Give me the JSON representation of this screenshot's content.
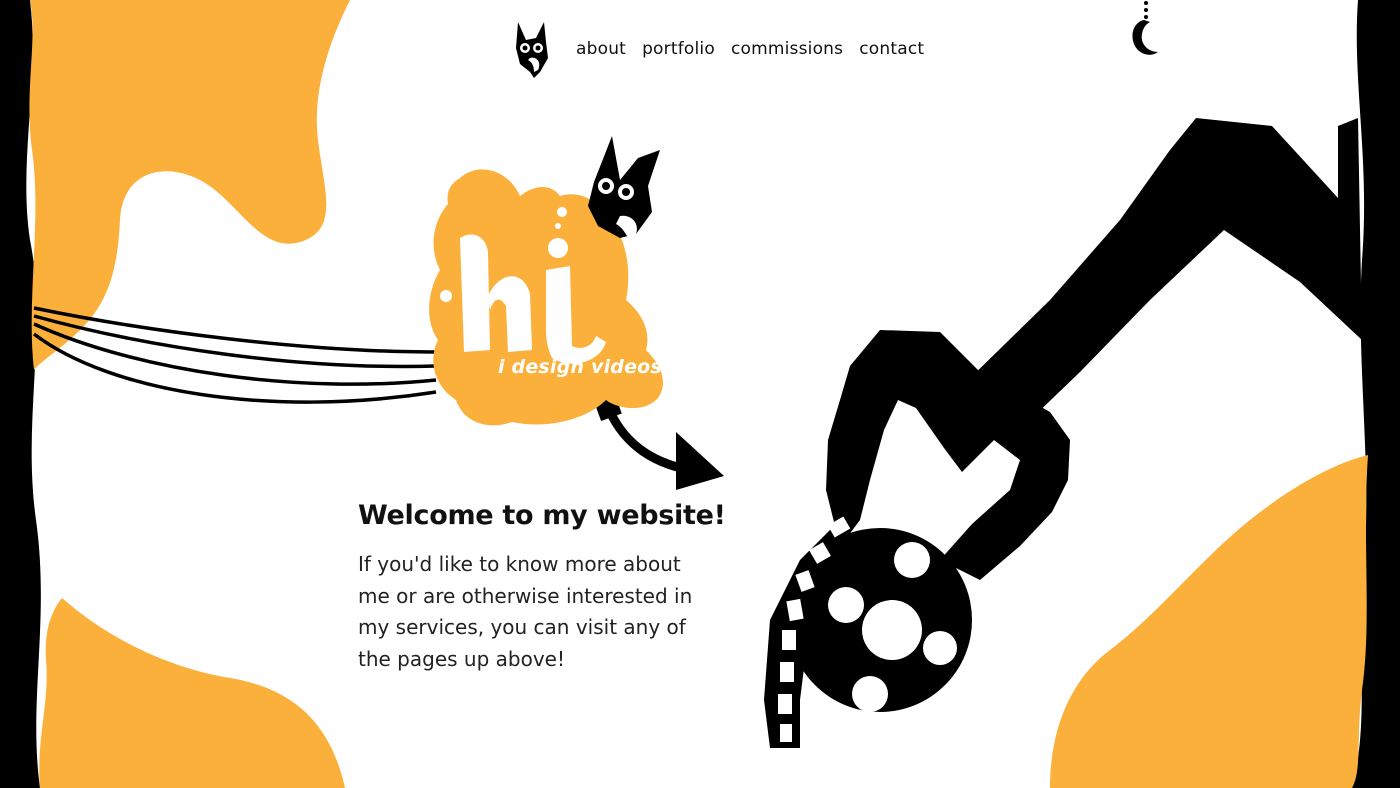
{
  "colors": {
    "accent": "#fbb03b",
    "ink": "#000000",
    "paper": "#ffffff"
  },
  "nav": {
    "logo_icon": "fox-mascot-icon",
    "items": [
      {
        "label": "about"
      },
      {
        "label": "portfolio"
      },
      {
        "label": "commissions"
      },
      {
        "label": "contact"
      }
    ],
    "theme_toggle_icon": "moon-pendant-icon"
  },
  "hero": {
    "hi_word": "hi.",
    "tagline": "i design videos.",
    "mascot_icon": "fox-mascot-icon",
    "arrow_icon": "curved-arrow-icon",
    "illustration_icon": "robot-claw-film-reel-icon"
  },
  "welcome": {
    "heading": "Welcome to my website!",
    "body": "If you'd like to know more about me or are otherwise interested in my services, you can visit any of the pages up above!"
  }
}
